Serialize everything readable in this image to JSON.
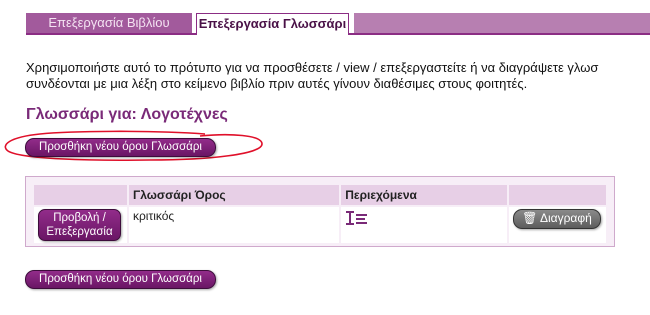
{
  "tabs": {
    "inactive_label": "Επεξεργασία Βιβλίου",
    "active_label": "Επεξεργασία Γλωσσάρι"
  },
  "intro": {
    "line1": "Χρησιμοποιήστε αυτό το πρότυπο για να προσθέσετε / view / επεξεργαστείτε ή να διαγράψετε γλωσ",
    "line2": "συνδέονται με μια λέξη στο κείμενο βιβλίο πριν αυτές γίνουν διαθέσιμες στους φοιτητές."
  },
  "title": "Γλωσσάρι για: Λογοτέχνες",
  "buttons": {
    "add_term_top": "Προσθήκη νέου όρου Γλωσσάρι",
    "add_term_bottom": "Προσθήκη νέου όρου Γλωσσάρι"
  },
  "table": {
    "headers": [
      "",
      "Γλωσσάρι Όρος",
      "Περιεχόμενα",
      ""
    ],
    "rows": [
      {
        "view_edit_line1": "Προβολή /",
        "view_edit_line2": "Επεξεργασία",
        "term": "κριτικός",
        "content_icon": "content-edit-icon",
        "delete_label": "Διαγραφή",
        "delete_icon": "trash-icon"
      }
    ]
  },
  "colors": {
    "accent": "#7a2a78",
    "button": "#7a1c73",
    "tab_inactive": "#a25a9c",
    "header_bg": "#e7cfe6",
    "annotation": "#e0102a"
  }
}
